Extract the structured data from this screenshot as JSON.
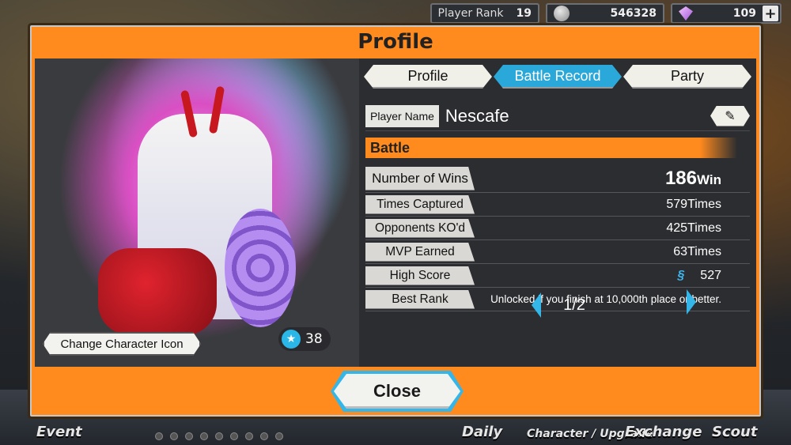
{
  "topbar": {
    "player_rank_label": "Player Rank",
    "player_rank_value": "19",
    "coins": "546328",
    "gems": "109",
    "plus": "+"
  },
  "bottom_nav": {
    "event": "Event",
    "daily": "Daily",
    "character_upgrade": "Character / Upgrade",
    "exchange": "Exchange",
    "scout": "Scout"
  },
  "dialog": {
    "title": "Profile",
    "tabs": [
      {
        "label": "Profile",
        "active": false
      },
      {
        "label": "Battle Record",
        "active": true
      },
      {
        "label": "Party",
        "active": false
      }
    ],
    "player_name_label": "Player Name",
    "player_name": "Nescafe",
    "section_title": "Battle",
    "character_level": "38",
    "change_icon_label": "Change Character Icon",
    "stats": {
      "wins": {
        "label": "Number of Wins",
        "value": "186",
        "unit": "Win"
      },
      "captured": {
        "label": "Times Captured",
        "value": "579Times"
      },
      "ko": {
        "label": "Opponents KO'd",
        "value": "425Times"
      },
      "mvp": {
        "label": "MVP Earned",
        "value": "63Times"
      },
      "high_score": {
        "label": "High Score",
        "value": "527"
      },
      "best_rank": {
        "label": "Best Rank",
        "value": "Unlocked if you finish at 10,000th place or better."
      }
    },
    "pager": "1/2",
    "close_label": "Close"
  },
  "colors": {
    "accent_orange": "#ff8a1e",
    "active_tab": "#2aa8d9",
    "panel_dark": "#2c2d30"
  }
}
